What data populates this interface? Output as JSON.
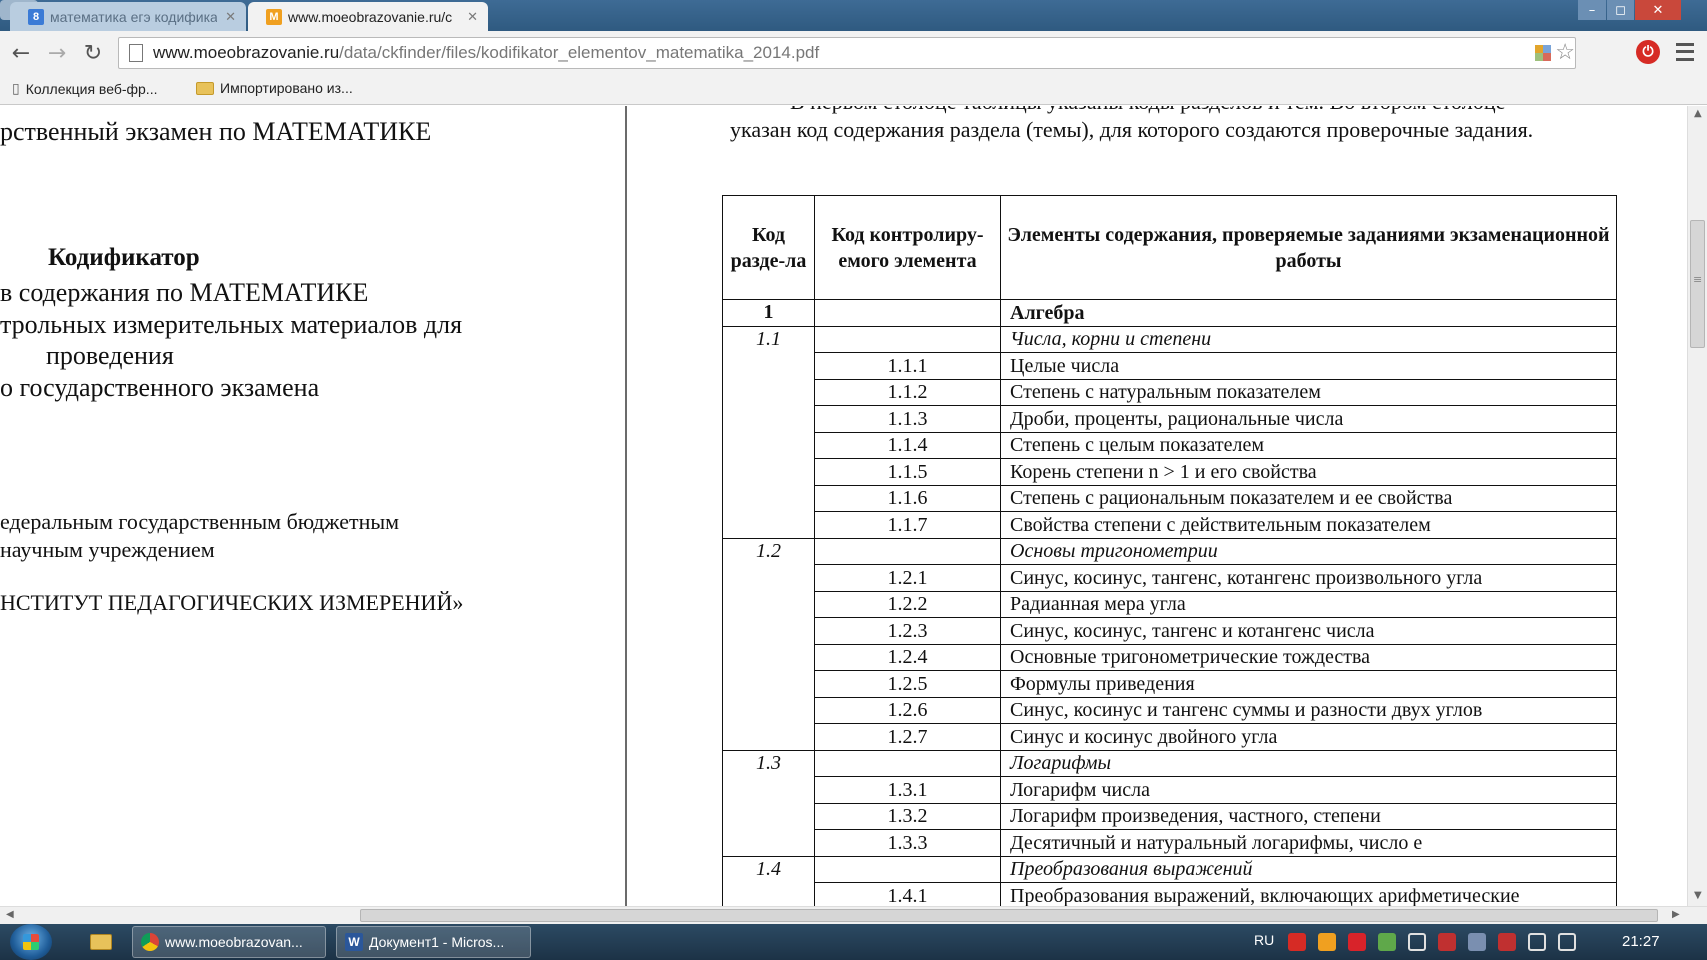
{
  "tabs": [
    {
      "title": "математика егэ кодифика",
      "favicon": "8",
      "active": false
    },
    {
      "title": "www.moeobrazovanie.ru/с",
      "favicon": "M",
      "active": true
    }
  ],
  "window_controls": {
    "minimize": "–",
    "maximize": "◻",
    "close": "✕"
  },
  "toolbar": {
    "back": "←",
    "forward": "→",
    "reload": "↻",
    "url_host": "www.moeobrazovanie.ru",
    "url_path": "/data/ckfinder/files/kodifikator_elementov_matematika_2014.pdf",
    "star": "☆",
    "ext": "⏻"
  },
  "bookmarks": [
    {
      "label": "Коллекция веб-фр...",
      "icon": "page-icon"
    },
    {
      "label": "Импортировано из...",
      "icon": "folder-icon"
    }
  ],
  "left_page": {
    "exam_line": "рственный экзамен по МАТЕМАТИКЕ",
    "title": "Кодификатор",
    "lines": [
      "в содержания по МАТЕМАТИКЕ",
      "трольных измерительных материалов для",
      "проведения",
      "о государственного экзамена"
    ],
    "org_lines": [
      "едеральным государственным бюджетным",
      "научным учреждением",
      "НСТИТУТ ПЕДАГОГИЧЕСКИХ ИЗМЕРЕНИЙ»"
    ]
  },
  "right_page": {
    "intro_partial": "В первом столбце таблицы указаны коды разделов и тем. Во втором столбце",
    "intro": "указан код содержания раздела (темы), для которого создаются проверочные задания.",
    "table": {
      "headers": [
        "Код разде-ла",
        "Код контролиру-емого элемента",
        "Элементы содержания, проверяемые заданиями экзаменационной работы"
      ],
      "rows": [
        {
          "section": "1",
          "code": "",
          "text": "Алгебра",
          "style": "bold"
        },
        {
          "section": "1.1",
          "code": "",
          "text": "Числа, корни и степени",
          "style": "italic"
        },
        {
          "section": "",
          "code": "1.1.1",
          "text": "Целые числа",
          "style": "normal"
        },
        {
          "section": "",
          "code": "1.1.2",
          "text": "Степень с натуральным показателем",
          "style": "normal"
        },
        {
          "section": "",
          "code": "1.1.3",
          "text": "Дроби, проценты, рациональные числа",
          "style": "normal"
        },
        {
          "section": "",
          "code": "1.1.4",
          "text": "Степень с целым показателем",
          "style": "normal"
        },
        {
          "section": "",
          "code": "1.1.5",
          "text": "Корень степени n > 1 и его свойства",
          "style": "normal"
        },
        {
          "section": "",
          "code": "1.1.6",
          "text": "Степень с рациональным показателем и ее свойства",
          "style": "normal"
        },
        {
          "section": "",
          "code": "1.1.7",
          "text": "Свойства степени с действительным показателем",
          "style": "normal"
        },
        {
          "section": "1.2",
          "code": "",
          "text": "Основы тригонометрии",
          "style": "italic"
        },
        {
          "section": "",
          "code": "1.2.1",
          "text": "Синус, косинус, тангенс, котангенс произвольного угла",
          "style": "normal"
        },
        {
          "section": "",
          "code": "1.2.2",
          "text": "Радианная мера угла",
          "style": "normal"
        },
        {
          "section": "",
          "code": "1.2.3",
          "text": "Синус, косинус, тангенс и котангенс числа",
          "style": "normal"
        },
        {
          "section": "",
          "code": "1.2.4",
          "text": "Основные тригонометрические тождества",
          "style": "normal"
        },
        {
          "section": "",
          "code": "1.2.5",
          "text": "Формулы приведения",
          "style": "normal"
        },
        {
          "section": "",
          "code": "1.2.6",
          "text": "Синус, косинус и тангенс суммы и разности двух углов",
          "style": "normal"
        },
        {
          "section": "",
          "code": "1.2.7",
          "text": "Синус и косинус двойного угла",
          "style": "normal"
        },
        {
          "section": "1.3",
          "code": "",
          "text": "Логарифмы",
          "style": "italic"
        },
        {
          "section": "",
          "code": "1.3.1",
          "text": "Логарифм числа",
          "style": "normal"
        },
        {
          "section": "",
          "code": "1.3.2",
          "text": "Логарифм произведения, частного, степени",
          "style": "normal"
        },
        {
          "section": "",
          "code": "1.3.3",
          "text": "Десятичный и натуральный логарифмы, число e",
          "style": "normal"
        },
        {
          "section": "1.4",
          "code": "",
          "text": "Преобразования выражений",
          "style": "italic"
        },
        {
          "section": "",
          "code": "1.4.1",
          "text": "Преобразования выражений, включающих арифметические",
          "style": "normal"
        }
      ]
    }
  },
  "taskbar": {
    "tasks": [
      {
        "label": "www.moeobrazovan...",
        "icon": "chrome-icon"
      },
      {
        "label": "Документ1 - Micros...",
        "icon": "word-icon",
        "icon_letter": "W"
      }
    ],
    "language": "RU",
    "clock": "21:27",
    "tray_colors": [
      "#d62b25",
      "#f0a020",
      "#d8232a",
      "#5fa84a",
      "#ffffff",
      "#c03030",
      "#7a8fb0",
      "#c03030",
      "#ffffff",
      "#ffffff"
    ]
  }
}
